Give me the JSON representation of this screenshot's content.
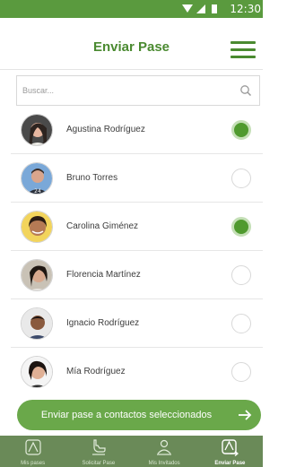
{
  "status_bar": {
    "time": "12:30"
  },
  "header": {
    "title": "Enviar Pase"
  },
  "search": {
    "placeholder": "Buscar..."
  },
  "contacts": [
    {
      "name": "Agustina Rodríguez",
      "selected": true
    },
    {
      "name": "Bruno Torres",
      "selected": false
    },
    {
      "name": "Carolina Giménez",
      "selected": true
    },
    {
      "name": "Florencia Martínez",
      "selected": false
    },
    {
      "name": "Ignacio Rodríguez",
      "selected": false
    },
    {
      "name": "Mía Rodríguez",
      "selected": false
    }
  ],
  "send_button": {
    "label": "Enviar pase a contactos seleccionados"
  },
  "bottom_nav": {
    "items": [
      {
        "label": "Mis pases",
        "icon": "pass-icon",
        "active": false
      },
      {
        "label": "Solicitar Pase",
        "icon": "request-hand-icon",
        "active": false
      },
      {
        "label": "Mis Invitados",
        "icon": "guests-icon",
        "active": false
      },
      {
        "label": "Enviar Pase",
        "icon": "send-pass-icon",
        "active": true
      }
    ]
  },
  "colors": {
    "primary": "#4a8a30",
    "status_bar": "#5a9a3e",
    "button": "#6aa84a",
    "nav": "#6a8a58"
  }
}
